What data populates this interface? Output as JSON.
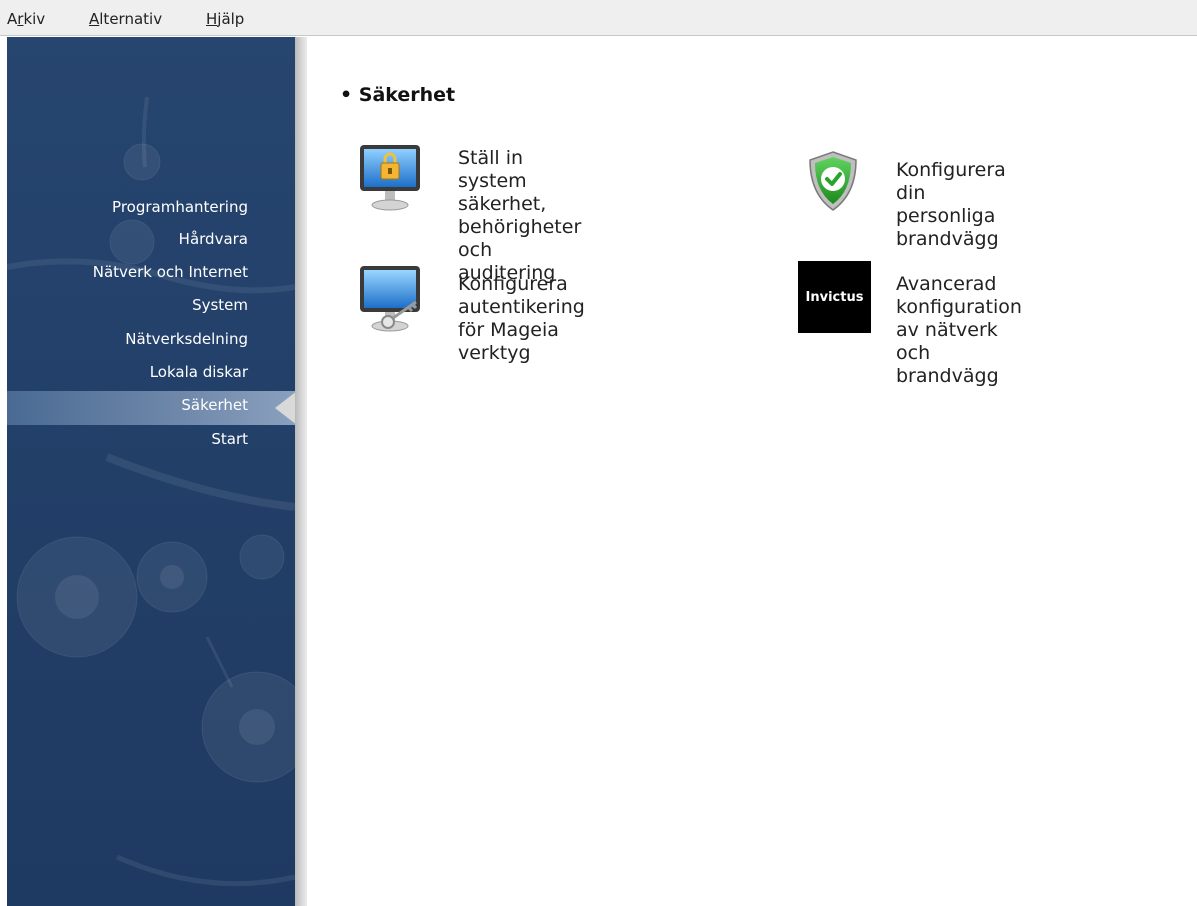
{
  "menubar": {
    "items": [
      {
        "pre": "A",
        "acc": "r",
        "post": "kiv"
      },
      {
        "pre": "",
        "acc": "A",
        "post": "lternativ"
      },
      {
        "pre": "",
        "acc": "H",
        "post": "jälp"
      }
    ]
  },
  "sidebar": {
    "items": [
      {
        "label": "Programhantering"
      },
      {
        "label": "Hårdvara"
      },
      {
        "label": "Nätverk och Internet"
      },
      {
        "label": "System"
      },
      {
        "label": "Nätverksdelning"
      },
      {
        "label": "Lokala diskar"
      },
      {
        "label": "Säkerhet",
        "selected": true
      },
      {
        "label": "Start"
      }
    ]
  },
  "main": {
    "section_title": "• Säkerhet",
    "tools": [
      {
        "label": "Ställ in system säkerhet,\nbehörigheter och\nauditering",
        "icon": "monitor-lock-icon"
      },
      {
        "label": "Konfigurera din personliga\nbrandvägg",
        "icon": "shield-check-icon"
      },
      {
        "label": "Konfigurera autentikering\nför Mageia verktyg",
        "icon": "monitor-key-icon"
      },
      {
        "label": "Avancerad konfiguration\nav nätverk och brandvägg",
        "icon": "invictus-logo",
        "icon_text": "Invictus"
      }
    ]
  },
  "colors": {
    "sidebar_bg": "#223f68",
    "selected_bar": "#6f88aa",
    "shield_green": "#2aa32a"
  }
}
